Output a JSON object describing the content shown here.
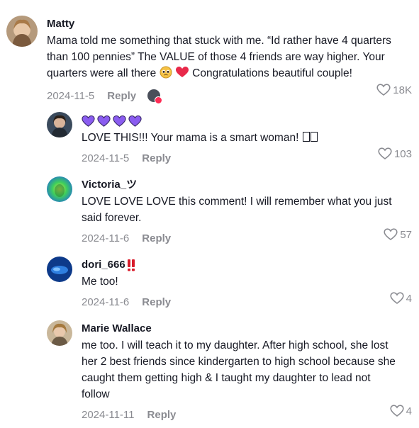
{
  "comments": [
    {
      "username": "Matty",
      "text_line1": "Mama told me something that stuck with me. “Id rather have 4 quarters",
      "text_line2": "than 100 pennies” The VALUE of those 4 friends are way higher. Your",
      "text_line3_a": "quarters were all there",
      "text_line3_b": "Congratulations beautiful couple!",
      "date": "2024-11-5",
      "reply": "Reply",
      "likes": "18K"
    },
    {
      "username": "",
      "text": "LOVE THIS!!! Your mama is a smart woman!",
      "date": "2024-11-5",
      "reply": "Reply",
      "likes": "103"
    },
    {
      "username": "Victoria_ツ",
      "text_line1": "LOVE LOVE LOVE this comment! I will remember what you just",
      "text_line2": "said forever.",
      "date": "2024-11-6",
      "reply": "Reply",
      "likes": "57"
    },
    {
      "username": "dori_666",
      "text": "Me too!",
      "date": "2024-11-6",
      "reply": "Reply",
      "likes": "4"
    },
    {
      "username": "Marie Wallace",
      "text_line1": "me too. I will teach it to my daughter. After high school, she lost",
      "text_line2": "her 2 best friends since kindergarten to high school because she",
      "text_line3": "caught them getting high & I taught my daughter to lead not",
      "text_line4": "follow",
      "date": "2024-11-11",
      "reply": "Reply",
      "likes": "4"
    }
  ],
  "colors": {
    "text": "#161823",
    "meta": "#8a8b91",
    "purple_heart": "#8a5cf0",
    "red_heart": "#e8294a"
  },
  "icons": [
    "heart-outline-icon",
    "purple-heart-icon",
    "red-heart-icon",
    "pleading-face-icon",
    "double-exclamation-icon"
  ]
}
